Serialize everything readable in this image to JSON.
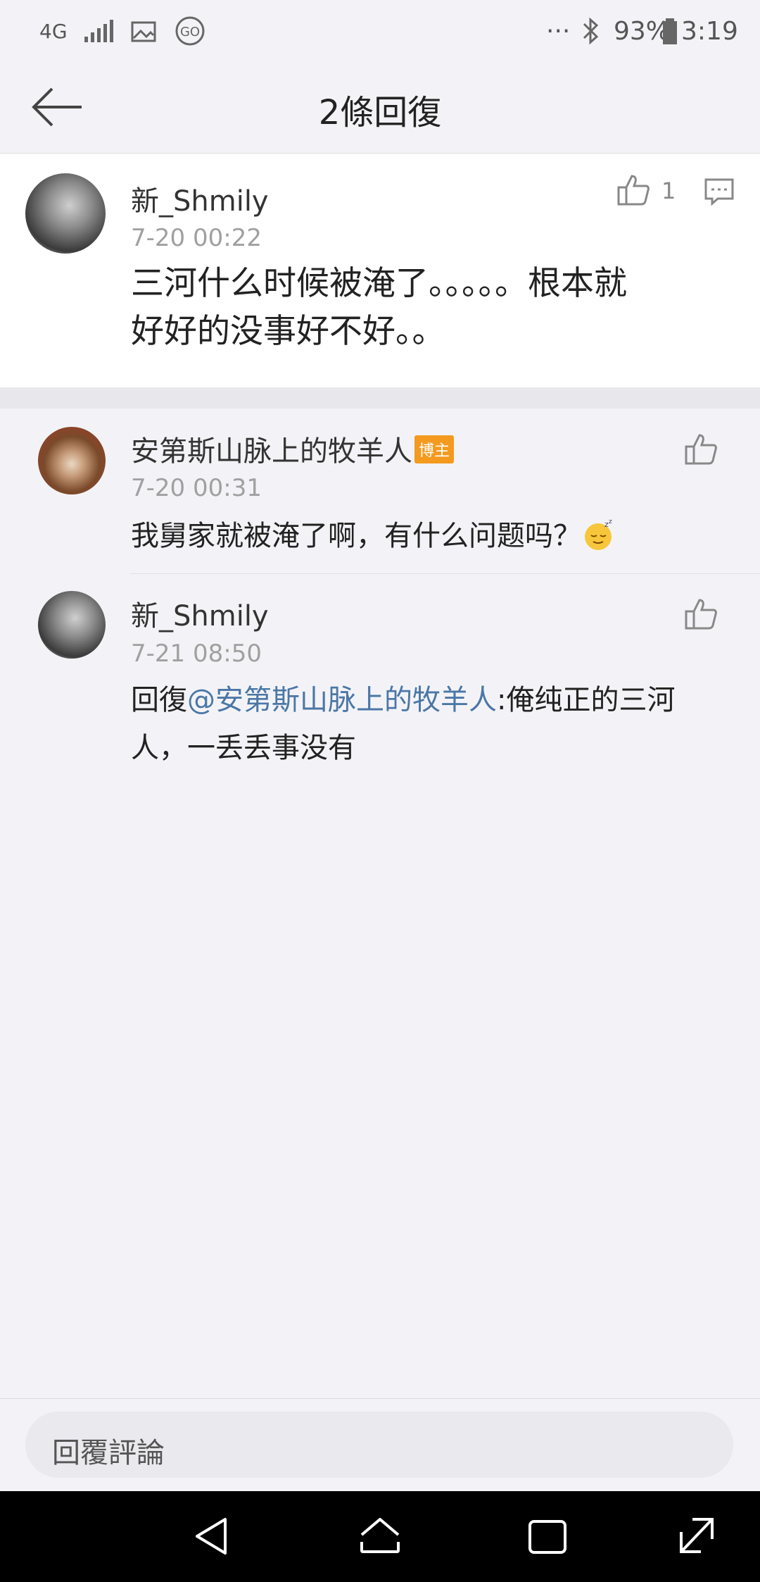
{
  "status_bar": {
    "network": "4G",
    "battery": "93%",
    "time": "3:19",
    "overflow": "···"
  },
  "header": {
    "title": "2條回復"
  },
  "main_comment": {
    "author": "新_Shmily",
    "time": "7-20 00:22",
    "like_count": "1",
    "text_line1": "三河什么时候被淹了。。。。。根本就",
    "text_line2": "好好的没事好不好。。"
  },
  "replies": [
    {
      "author": "安第斯山脉上的牧羊人",
      "badge": "博主",
      "time": "7-20 00:31",
      "text": "我舅家就被淹了啊，有什么问题吗？"
    },
    {
      "author": "新_Shmily",
      "time": "7-21 08:50",
      "prefix": "回復",
      "mention": "@安第斯山脉上的牧羊人",
      "text_line1": ":俺纯正的三河",
      "text_line2": "人，一丢丢事没有"
    }
  ],
  "footer": {
    "placeholder": "回覆評論"
  },
  "colors": {
    "accent_link": "#4b77a6",
    "badge": "#f39a1f",
    "background": "#f3f3f7"
  }
}
